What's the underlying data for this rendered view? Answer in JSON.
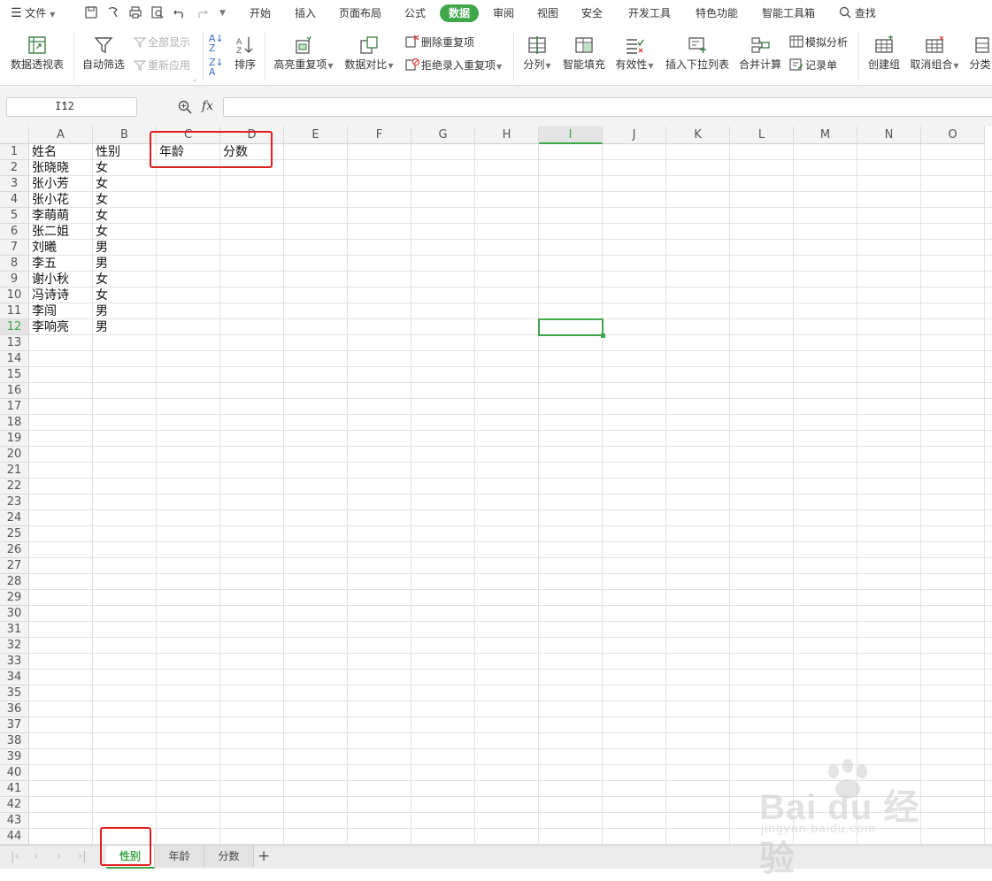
{
  "menubar": {
    "file_label": "文件",
    "tabs": [
      "开始",
      "插入",
      "页面布局",
      "公式",
      "数据",
      "审阅",
      "视图",
      "安全",
      "开发工具",
      "特色功能",
      "智能工具箱"
    ],
    "active_tab": "数据",
    "search_label": "查找"
  },
  "ribbon": {
    "pivot": "数据透视表",
    "autofilter": "自动筛选",
    "show_all": "全部显示",
    "reapply": "重新应用",
    "sort": "排序",
    "highlight_dup": "高亮重复项",
    "compare": "数据对比",
    "remove_dup": "删除重复项",
    "reject_dup": "拒绝录入重复项",
    "split_col": "分列",
    "smart_fill": "智能填充",
    "validity": "有效性",
    "dropdown_list": "插入下拉列表",
    "consolidate": "合并计算",
    "simulate": "模拟分析",
    "record": "记录单",
    "group": "创建组",
    "ungroup": "取消组合",
    "subtotal": "分类"
  },
  "formula_bar": {
    "name_box": "I12",
    "fx": "fx",
    "value": ""
  },
  "sheet": {
    "columns": [
      "A",
      "B",
      "C",
      "D",
      "E",
      "F",
      "G",
      "H",
      "I",
      "J",
      "K",
      "L",
      "M",
      "N",
      "O"
    ],
    "selected_column": "I",
    "selected_row": 12,
    "row_count": 44,
    "rows": [
      [
        "姓名",
        "性别",
        "年龄",
        "分数"
      ],
      [
        "张晓晓",
        "女",
        "",
        ""
      ],
      [
        "张小芳",
        "女",
        "",
        ""
      ],
      [
        "张小花",
        "女",
        "",
        ""
      ],
      [
        "李萌萌",
        "女",
        "",
        ""
      ],
      [
        "张二姐",
        "女",
        "",
        ""
      ],
      [
        "刘曦",
        "男",
        "",
        ""
      ],
      [
        "李五",
        "男",
        "",
        ""
      ],
      [
        "谢小秋",
        "女",
        "",
        ""
      ],
      [
        "冯诗诗",
        "女",
        "",
        ""
      ],
      [
        "李闯",
        "男",
        "",
        ""
      ],
      [
        "李响亮",
        "男",
        "",
        ""
      ]
    ]
  },
  "sheet_tabs": {
    "tabs": [
      "性别",
      "年龄",
      "分数"
    ],
    "active": "性别",
    "add": "+"
  },
  "watermark": {
    "brand": "Bai du 经验",
    "url": "jingyan.baidu.com"
  },
  "colors": {
    "accent": "#3fa74a",
    "highlight": "#e02020"
  }
}
